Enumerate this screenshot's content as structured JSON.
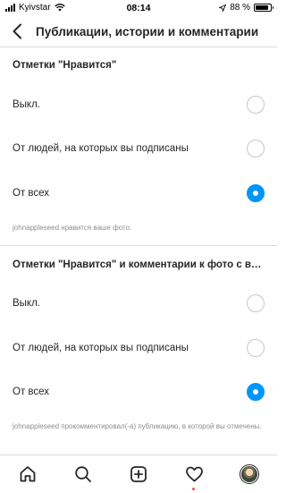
{
  "status_bar": {
    "carrier": "Kyivstar",
    "time": "08:14",
    "battery_label": "88 %",
    "battery_level": 0.88
  },
  "header": {
    "title": "Публикации, истории и комментарии"
  },
  "sections": [
    {
      "title": "Отметки \"Нравится\"",
      "options": [
        "Выкл.",
        "От людей, на которых вы подписаны",
        "От всех"
      ],
      "selected_index": 2,
      "hint": "johnappleseed нравится ваше фото."
    },
    {
      "title": "Отметки \"Нравится\" и комментарии к фото с вами",
      "options": [
        "Выкл.",
        "От людей, на которых вы подписаны",
        "От всех"
      ],
      "selected_index": 2,
      "hint": "johnappleseed прокомментировал(-а) публикацию, в которой вы отмечены."
    }
  ],
  "tab_bar": {
    "tabs": [
      "home-icon",
      "search-icon",
      "new-post-icon",
      "activity-icon",
      "profile-avatar"
    ]
  },
  "colors": {
    "accent": "#0095f6",
    "notification_dot": "#ed4956"
  }
}
